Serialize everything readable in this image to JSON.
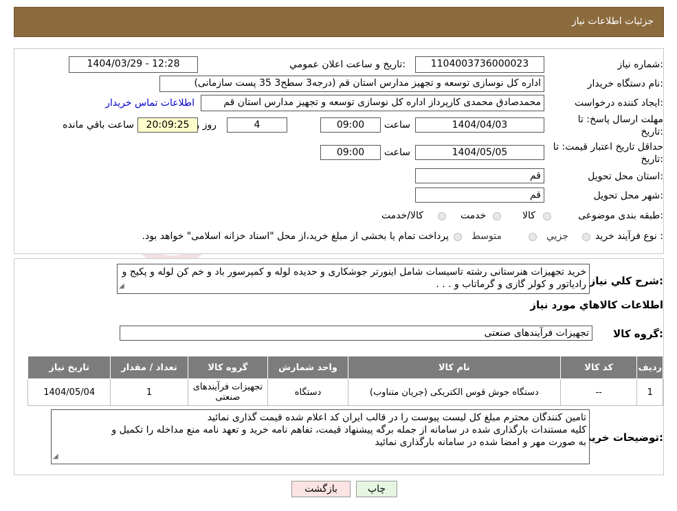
{
  "header": {
    "title": "جزئیات اطلاعات نیاز"
  },
  "form": {
    "need_number_label": "شماره نیاز:",
    "need_number": "1104003736000023",
    "announce_label": "تاریخ و ساعت اعلان عمومي:",
    "announce_value": "1404/03/29 - 12:28",
    "buyer_label": "نام دستگاه خریدار:",
    "buyer_value": "اداره کل نوسازی   توسعه و تجهیز مدارس استان قم (درجه3 سطح3  35 پست سازمانی)",
    "creator_label": "ایجاد کننده درخواست:",
    "creator_value": "محمدصادق محمدی کارپرداز  اداره کل نوسازی   توسعه و تجهیز مدارس استان قم",
    "contact_link": "اطلاعات تماس خریدار",
    "deadline_label_1": "مهلت ارسال پاسخ: تا",
    "deadline_label_2": "تاریخ:",
    "deadline_date": "1404/04/03",
    "time_label": "ساعت",
    "deadline_time": "09:00",
    "days_value": "4",
    "days_label": "روز و",
    "remaining_time": "20:09:25",
    "remaining_label": "ساعت باقي مانده",
    "validity_label_1": "حداقل تاریخ اعتبار قیمت: تا",
    "validity_label_2": "تاریخ:",
    "validity_date": "1404/05/05",
    "validity_time": "09:00",
    "province_label": "استان محل تحویل:",
    "province_value": "قم",
    "city_label": "شهر محل تحویل:",
    "city_value": "قم",
    "category_label": "طبقه بندی موضوعی:",
    "category_options": [
      "کالا",
      "خدمت",
      "کالا/خدمت"
    ],
    "process_label": "نوع فرآیند خرید :",
    "process_options": [
      "جزیي",
      "متوسط"
    ],
    "process_note": "پرداخت تمام یا بخشی از مبلغ خرید،از محل \"اسناد خزانه اسلامی\" خواهد بود."
  },
  "description": {
    "label": "شرح کلي نیاز:",
    "text": "خرید تجهیزات هنرستانی رشته تاسیسات شامل اینورتر جوشکاری و حدیده لوله و کمپرسور باد و خم کن لوله و پکیج و رادیاتور و کولر گازی و گرماتاب و . . ."
  },
  "goods": {
    "section_title": "اطلاعات کالاهاي مورد نیاز",
    "group_label": "گروه کالا:",
    "group_value": "تجهیزات فرآیندهای صنعتی",
    "columns": [
      "ردیف",
      "کد کالا",
      "نام کالا",
      "واحد شمارش",
      "گروه کالا",
      "تعداد / مقدار",
      "تاریخ نیاز"
    ],
    "rows": [
      {
        "row": "1",
        "code": "--",
        "name": "دستگاه جوش قوس الکتریکی (جریان متناوب)",
        "unit": "دستگاه",
        "group": "تجهیزات فرآیندهای صنعتی",
        "qty": "1",
        "date": "1404/05/04"
      }
    ]
  },
  "buyer_notes": {
    "label": "توضیحات خریدار:",
    "lines": [
      "تامین کنندگان محترم مبلغ کل لیست پیوست را در قالب ایران کد اعلام شده قیمت گذاری نمائید",
      "کلیه مستندات بارگذاری شده در سامانه از جمله برگه پیشنهاد قیمت، تفاهم نامه خرید و تعهد نامه منع مداخله را تکمیل و",
      "به صورت مهر و امضا شده در سامانه بارگذاری نمائید"
    ]
  },
  "buttons": {
    "print": "چاپ",
    "back": "بازگشت"
  },
  "watermark": {
    "text": "AriaTender.neT"
  },
  "colors": {
    "header_bg": "#8b6a3e",
    "table_header_bg": "#7c7c7c",
    "print_btn_bg": "#e6f5e0",
    "back_btn_bg": "#fbe3e3",
    "timer_bg": "#ffffcc",
    "link": "#0000cc"
  }
}
